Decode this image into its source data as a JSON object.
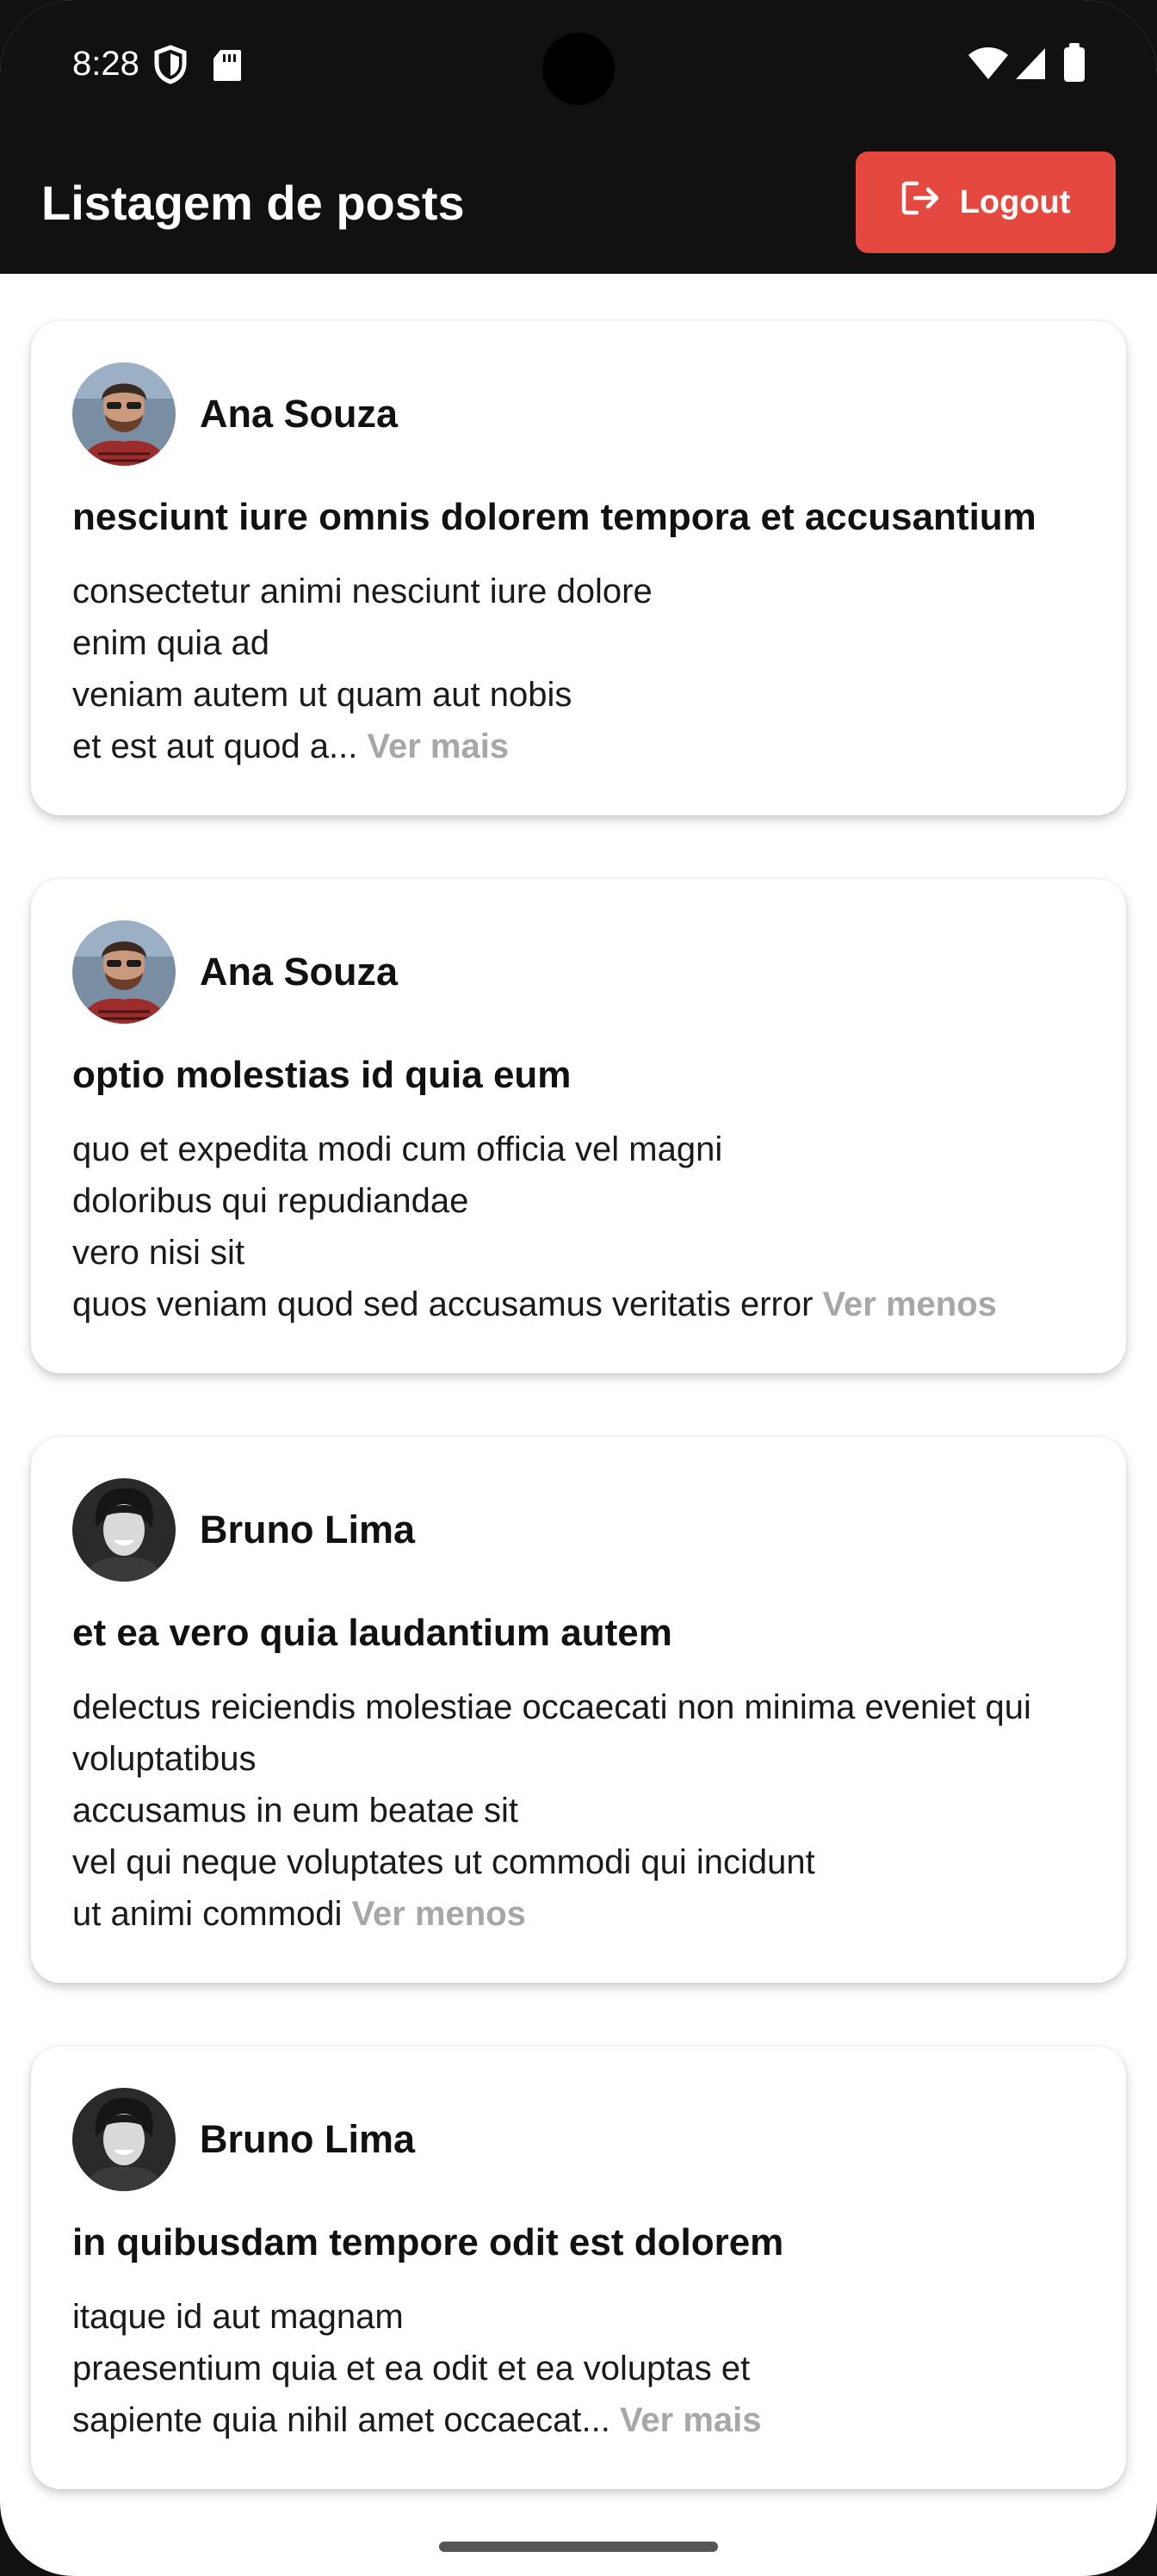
{
  "status_bar": {
    "time": "8:28",
    "left_icons": [
      "shield-icon",
      "sd-card-icon"
    ],
    "right_icons": [
      "wifi-icon",
      "signal-icon",
      "battery-icon"
    ]
  },
  "app_bar": {
    "title": "Listagem de posts",
    "logout_label": "Logout",
    "logout_icon": "logout-icon",
    "logout_color": "#e5483e",
    "background": "#111111"
  },
  "posts": [
    {
      "author": "Ana Souza",
      "title": "nesciunt iure omnis dolorem tempora et accusantium",
      "body": "consectetur animi nesciunt iure dolore\nenim quia ad\nveniam autem ut quam aut nobis\net est aut quod a...",
      "toggle": "Ver mais"
    },
    {
      "author": "Ana Souza",
      "title": "optio molestias id quia eum",
      "body": "quo et expedita modi cum officia vel magni\ndoloribus qui repudiandae\nvero nisi sit\nquos veniam quod sed accusamus veritatis error",
      "toggle": "Ver menos"
    },
    {
      "author": "Bruno Lima",
      "title": "et ea vero quia laudantium autem",
      "body": "delectus reiciendis molestiae occaecati non minima eveniet qui voluptatibus\naccusamus in eum beatae sit\nvel qui neque voluptates ut commodi qui incidunt\nut animi commodi",
      "toggle": "Ver menos"
    },
    {
      "author": "Bruno Lima",
      "title": "in quibusdam tempore odit est dolorem",
      "body": "itaque id aut magnam\npraesentium quia et ea odit et ea voluptas et\nsapiente quia nihil amet occaecat...",
      "toggle": "Ver mais"
    }
  ]
}
